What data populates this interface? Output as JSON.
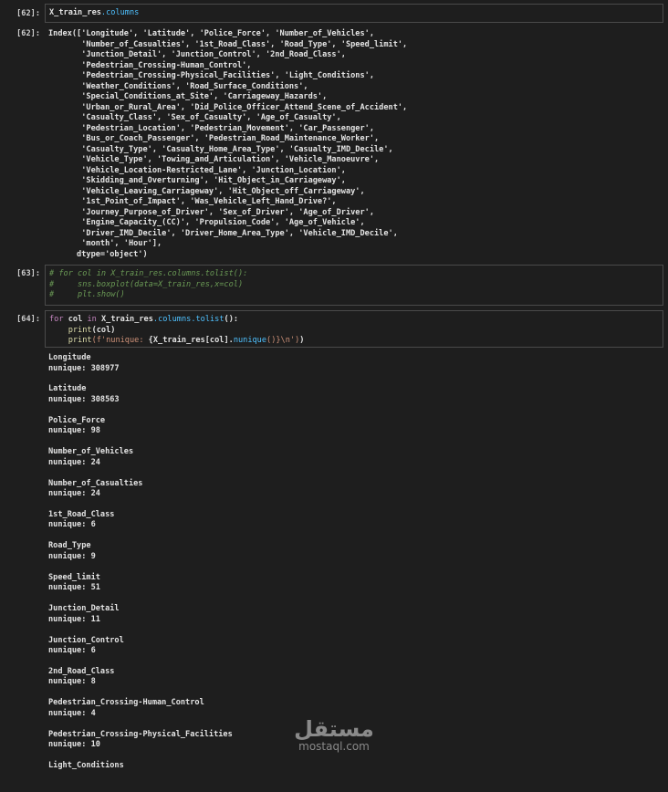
{
  "cells": {
    "c62": {
      "in_prompt": "[62]:",
      "out_prompt": "[62]:",
      "code_var": "X_train_res",
      "code_attr": ".columns",
      "output_lines": [
        "Index(['Longitude', 'Latitude', 'Police_Force', 'Number_of_Vehicles',",
        "       'Number_of_Casualties', '1st_Road_Class', 'Road_Type', 'Speed_limit',",
        "       'Junction_Detail', 'Junction_Control', '2nd_Road_Class',",
        "       'Pedestrian_Crossing-Human_Control',",
        "       'Pedestrian_Crossing-Physical_Facilities', 'Light_Conditions',",
        "       'Weather_Conditions', 'Road_Surface_Conditions',",
        "       'Special_Conditions_at_Site', 'Carriageway_Hazards',",
        "       'Urban_or_Rural_Area', 'Did_Police_Officer_Attend_Scene_of_Accident',",
        "       'Casualty_Class', 'Sex_of_Casualty', 'Age_of_Casualty',",
        "       'Pedestrian_Location', 'Pedestrian_Movement', 'Car_Passenger',",
        "       'Bus_or_Coach_Passenger', 'Pedestrian_Road_Maintenance_Worker',",
        "       'Casualty_Type', 'Casualty_Home_Area_Type', 'Casualty_IMD_Decile',",
        "       'Vehicle_Type', 'Towing_and_Articulation', 'Vehicle_Manoeuvre',",
        "       'Vehicle_Location-Restricted_Lane', 'Junction_Location',",
        "       'Skidding_and_Overturning', 'Hit_Object_in_Carriageway',",
        "       'Vehicle_Leaving_Carriageway', 'Hit_Object_off_Carriageway',",
        "       '1st_Point_of_Impact', 'Was_Vehicle_Left_Hand_Drive?',",
        "       'Journey_Purpose_of_Driver', 'Sex_of_Driver', 'Age_of_Driver',",
        "       'Engine_Capacity_(CC)', 'Propulsion_Code', 'Age_of_Vehicle',",
        "       'Driver_IMD_Decile', 'Driver_Home_Area_Type', 'Vehicle_IMD_Decile',",
        "       'month', 'Hour'],",
        "      dtype='object')"
      ]
    },
    "c63": {
      "in_prompt": "[63]:",
      "comment_lines": [
        "# for col in X_train_res.columns.tolist():",
        "#     sns.boxplot(data=X_train_res,x=col)",
        "#     plt.show()"
      ]
    },
    "c64": {
      "in_prompt": "[64]:",
      "kw_for": "for",
      "var_col": "col",
      "kw_in": "in",
      "obj": "X_train_res",
      "attr1": ".columns",
      "attr2": ".tolist",
      "tail1": "():",
      "indent": "    ",
      "fn_print": "print",
      "arg_col": "(col)",
      "fstr_prefix": "(f'nunique: ",
      "fstr_expr": "{X_train_res[col].",
      "fstr_nunique": "nunique",
      "fstr_close": "()}\\n')",
      "fstr_tail": ")",
      "outputs": [
        {
          "name": "Longitude",
          "nunique": "nunique: 308977"
        },
        {
          "name": "Latitude",
          "nunique": "nunique: 308563"
        },
        {
          "name": "Police_Force",
          "nunique": "nunique: 98"
        },
        {
          "name": "Number_of_Vehicles",
          "nunique": "nunique: 24"
        },
        {
          "name": "Number_of_Casualties",
          "nunique": "nunique: 24"
        },
        {
          "name": "1st_Road_Class",
          "nunique": "nunique: 6"
        },
        {
          "name": "Road_Type",
          "nunique": "nunique: 9"
        },
        {
          "name": "Speed_limit",
          "nunique": "nunique: 51"
        },
        {
          "name": "Junction_Detail",
          "nunique": "nunique: 11"
        },
        {
          "name": "Junction_Control",
          "nunique": "nunique: 6"
        },
        {
          "name": "2nd_Road_Class",
          "nunique": "nunique: 8"
        },
        {
          "name": "Pedestrian_Crossing-Human_Control",
          "nunique": "nunique: 4"
        },
        {
          "name": "Pedestrian_Crossing-Physical_Facilities",
          "nunique": "nunique: 10"
        },
        {
          "name": "Light_Conditions",
          "nunique": ""
        }
      ]
    }
  },
  "watermark": {
    "arabic": "مستقل",
    "latin": "mostaql.com"
  }
}
